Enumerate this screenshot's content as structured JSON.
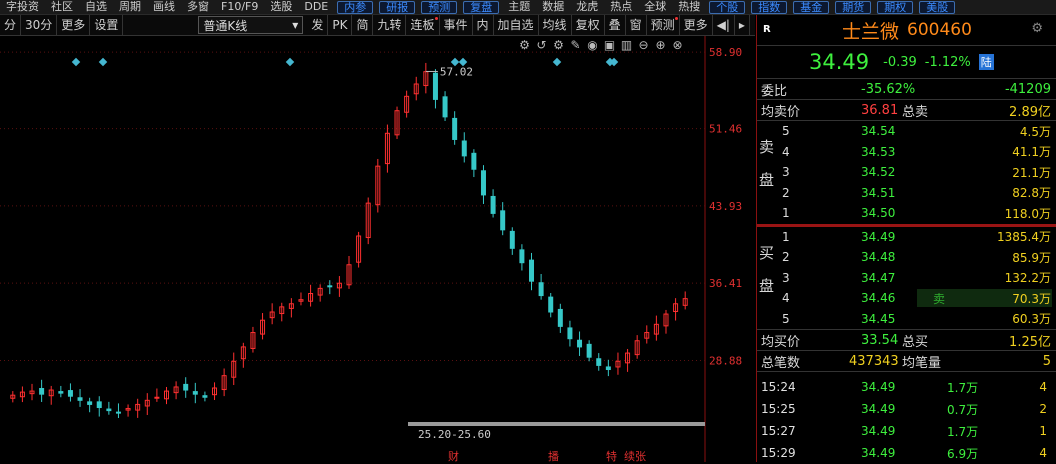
{
  "menubar": {
    "items": [
      "字投资",
      "社区",
      "自选",
      "周期",
      "画线",
      "多窗",
      "F10/F9",
      "选股",
      "DDE"
    ],
    "buttons": [
      "内参",
      "研报",
      "预测",
      "复盘",
      "主题",
      "数据",
      "龙虎",
      "热点",
      "全球",
      "热搜",
      "个股",
      "指数",
      "基金",
      "期货",
      "期权",
      "美股"
    ]
  },
  "toolbar": {
    "left": [
      "分",
      "30分",
      "更多",
      "设置"
    ],
    "kline_select": "普通K线",
    "mid": [
      "发",
      "PK",
      "简",
      "九转",
      "连板",
      "事件"
    ],
    "right": [
      "内",
      "加自选",
      "均线",
      "复权",
      "叠",
      "窗",
      "预测",
      "更多"
    ]
  },
  "chart_data": {
    "type": "candlestick",
    "y_ticks": [
      "58.90",
      "51.46",
      "43.93",
      "36.41",
      "28.88"
    ],
    "ylim": [
      22.5,
      59.5
    ],
    "max_label": "57.02",
    "range_label": "25.20-25.60",
    "bottom_markers": [
      "财",
      "播",
      "特",
      "续张"
    ],
    "up_color": "#ff3030",
    "down_color": "#36c8c8",
    "series": [
      25.5,
      25.8,
      25.9,
      25.6,
      26.0,
      25.7,
      25.4,
      25.0,
      24.6,
      24.3,
      24.0,
      23.8,
      24.2,
      24.6,
      25.0,
      25.3,
      25.9,
      26.3,
      26.0,
      25.6,
      25.3,
      26.2,
      27.4,
      28.8,
      30.2,
      31.6,
      32.8,
      33.6,
      34.1,
      34.4,
      34.8,
      35.4,
      35.9,
      36.1,
      36.4,
      38.2,
      41.0,
      44.2,
      47.8,
      51.0,
      53.2,
      54.6,
      55.8,
      57.0,
      54.3,
      52.6,
      50.4,
      48.8,
      47.5,
      45.0,
      43.2,
      41.6,
      39.8,
      38.4,
      36.6,
      35.2,
      33.6,
      32.2,
      31.0,
      30.2,
      29.2,
      28.4,
      28.0,
      28.8,
      29.6,
      30.8,
      31.6,
      32.4,
      33.4,
      34.4,
      34.9
    ]
  },
  "quote": {
    "market_tag": "R",
    "name": "士兰微",
    "code": "600460",
    "price": "34.49",
    "change": "-0.39",
    "pct": "-1.12%",
    "exchange_badge": "陆",
    "weibi_label": "委比",
    "weibi_pct": "-35.62%",
    "weibi_val": "-41209",
    "avg_sell_label": "均卖价",
    "avg_sell": "36.81",
    "total_sell_label": "总卖",
    "total_sell": "2.89亿",
    "sell_side_label": "卖盘",
    "buy_side_label": "买盘",
    "sells": [
      {
        "lv": "5",
        "price": "34.54",
        "vol": "4.5万"
      },
      {
        "lv": "4",
        "price": "34.53",
        "vol": "41.1万"
      },
      {
        "lv": "3",
        "price": "34.52",
        "vol": "21.1万"
      },
      {
        "lv": "2",
        "price": "34.51",
        "vol": "82.8万"
      },
      {
        "lv": "1",
        "price": "34.50",
        "vol": "118.0万"
      }
    ],
    "buys": [
      {
        "lv": "1",
        "price": "34.49",
        "vol": "1385.4万"
      },
      {
        "lv": "2",
        "price": "34.48",
        "vol": "85.9万"
      },
      {
        "lv": "3",
        "price": "34.47",
        "vol": "132.2万"
      },
      {
        "lv": "4",
        "price": "34.46",
        "vol": "70.3万"
      },
      {
        "lv": "5",
        "price": "34.45",
        "vol": "60.3万"
      }
    ],
    "sell_marker": "卖",
    "avg_buy_label": "均买价",
    "avg_buy": "33.54",
    "total_buy_label": "总买",
    "total_buy": "1.25亿",
    "total_trades_label": "总笔数",
    "total_trades": "437343",
    "avg_per_trade_label": "均笔量",
    "avg_per_trade": "5",
    "ticks": [
      {
        "time": "15:24",
        "price": "34.49",
        "vol": "1.7万",
        "n": "4"
      },
      {
        "time": "15:25",
        "price": "34.49",
        "vol": "0.7万",
        "n": "2"
      },
      {
        "time": "15:27",
        "price": "34.49",
        "vol": "1.7万",
        "n": "1"
      },
      {
        "time": "15:29",
        "price": "34.49",
        "vol": "6.9万",
        "n": "4"
      }
    ]
  }
}
